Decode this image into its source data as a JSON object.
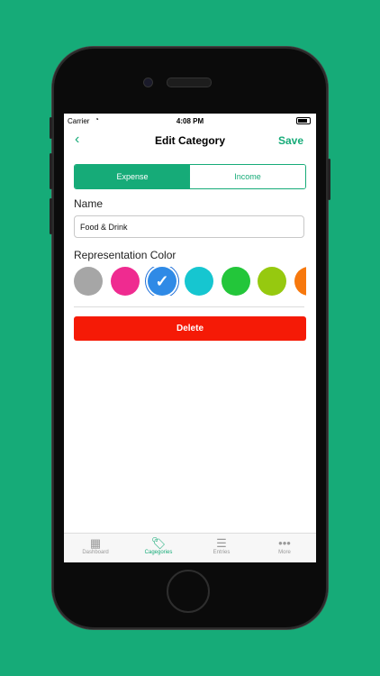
{
  "colors": {
    "accent": "#16ab78",
    "delete": "#f51a06",
    "background": "#16ab78"
  },
  "status": {
    "carrier": "Carrier",
    "time": "4:08 PM",
    "wifi_icon": "wifi-icon",
    "battery_icon": "battery-icon"
  },
  "navbar": {
    "back_icon": "chevron-left-icon",
    "back_glyph": "‹",
    "title": "Edit Category",
    "save": "Save"
  },
  "segment": {
    "items": [
      "Expense",
      "Income"
    ],
    "selected": "Expense"
  },
  "form": {
    "name_label": "Name",
    "name_value": "Food & Drink",
    "color_label": "Representation Color",
    "swatches": [
      {
        "color": "#a6a6a6",
        "selected": false
      },
      {
        "color": "#ef2b90",
        "selected": false
      },
      {
        "color": "#2f8ae6",
        "selected": true
      },
      {
        "color": "#16c6d0",
        "selected": false
      },
      {
        "color": "#23c63a",
        "selected": false
      },
      {
        "color": "#96c90f",
        "selected": false
      },
      {
        "color": "#f7780d",
        "selected": false
      }
    ],
    "delete_label": "Delete"
  },
  "tabbar": {
    "items": [
      {
        "label": "Dashboard",
        "icon": "grid-icon",
        "glyph": "▦",
        "active": false
      },
      {
        "label": "Cagegories",
        "icon": "tags-icon",
        "glyph": "🏷",
        "active": true
      },
      {
        "label": "Entries",
        "icon": "list-icon",
        "glyph": "☰",
        "active": false
      },
      {
        "label": "More",
        "icon": "more-icon",
        "glyph": "•••",
        "active": false
      }
    ]
  }
}
